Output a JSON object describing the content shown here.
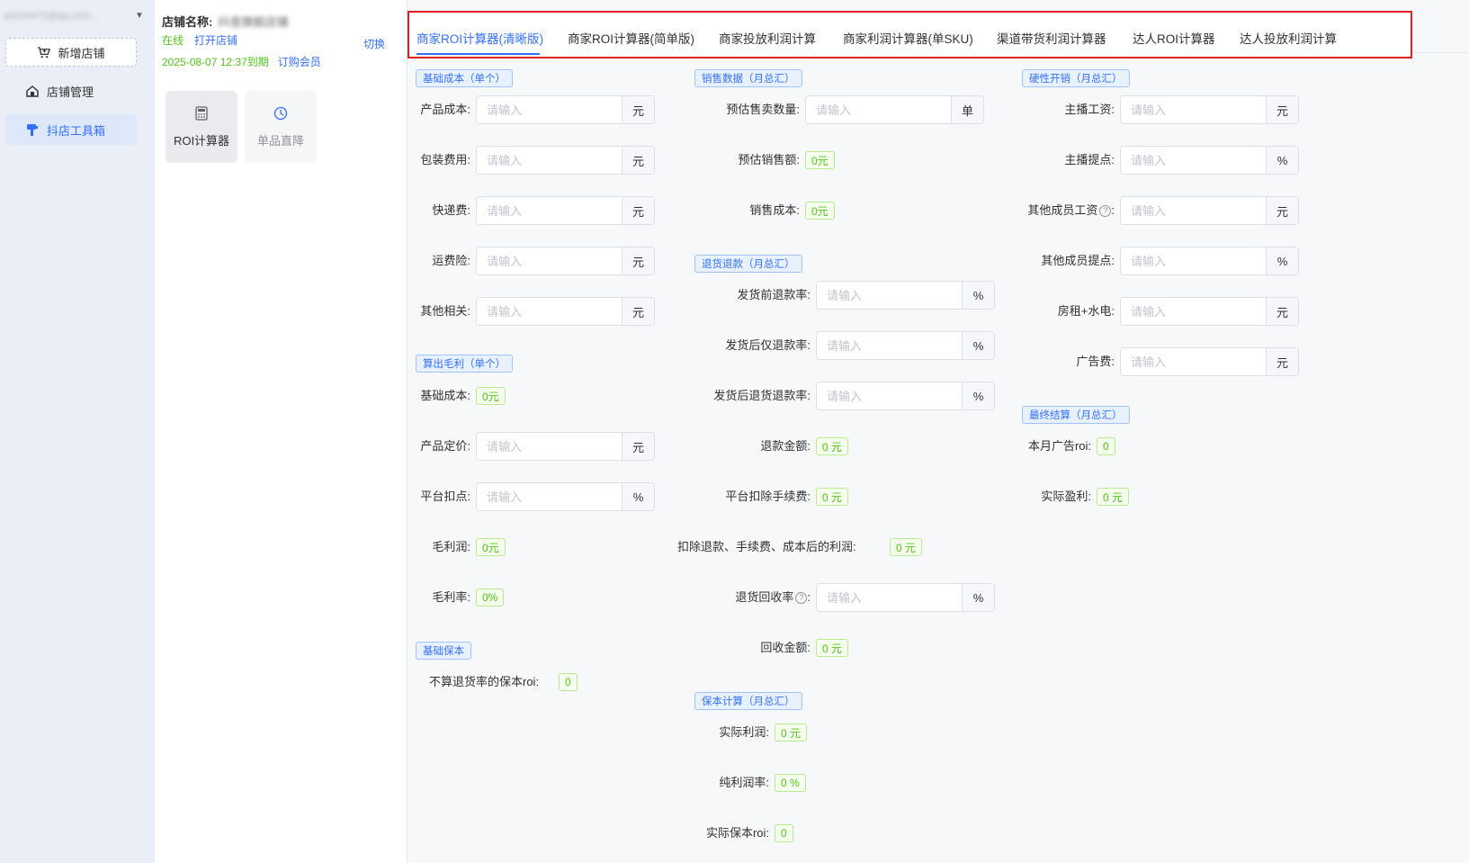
{
  "sidebar": {
    "account": "a0150472@qq.com...",
    "add_shop": "新增店铺",
    "items": [
      {
        "label": "店铺管理",
        "icon": "shop-icon"
      },
      {
        "label": "抖店工具箱",
        "icon": "toolbox-icon"
      }
    ]
  },
  "shop": {
    "name_label": "店铺名称:",
    "name_value": "抖音旗舰店铺",
    "status": "在线",
    "open_shop": "打开店铺",
    "switch": "切换",
    "expire": "2025-08-07 12:37到期",
    "subscribe": "订购会员",
    "tools": [
      {
        "label": "ROI计算器",
        "icon": "calculator-icon"
      },
      {
        "label": "单品直降",
        "icon": "clock-icon"
      }
    ]
  },
  "tabs": [
    "商家ROI计算器(清晰版)",
    "商家ROI计算器(简单版)",
    "商家投放利润计算",
    "商家利润计算器(单SKU)",
    "渠道带货利润计算器",
    "达人ROI计算器",
    "达人投放利润计算"
  ],
  "placeholder": "请输入",
  "col1": {
    "base_cost_tag": "基础成本（单个）",
    "product_cost": {
      "label": "产品成本:",
      "unit": "元"
    },
    "packaging": {
      "label": "包装费用:",
      "unit": "元"
    },
    "express": {
      "label": "快递费:",
      "unit": "元"
    },
    "freight_ins": {
      "label": "运费险:",
      "unit": "元"
    },
    "other": {
      "label": "其他相关:",
      "unit": "元"
    },
    "gross_tag": "算出毛利（单个）",
    "base_cost_total": {
      "label": "基础成本:",
      "value": "0元"
    },
    "price": {
      "label": "产品定价:",
      "unit": "元"
    },
    "platform_fee": {
      "label": "平台扣点:",
      "unit": "%"
    },
    "gross_profit": {
      "label": "毛利润:",
      "value": "0元"
    },
    "gross_rate": {
      "label": "毛利率:",
      "value": "0%"
    },
    "breakeven_tag": "基础保本",
    "breakeven_roi": {
      "label": "不算退货率的保本roi:",
      "value": "0"
    }
  },
  "col2": {
    "sales_tag": "销售数据（月总汇）",
    "est_qty": {
      "label": "预估售卖数量:",
      "unit": "单"
    },
    "est_sales": {
      "label": "预估销售额:",
      "value": "0元"
    },
    "sales_cost": {
      "label": "销售成本:",
      "value": "0元"
    },
    "refund_tag": "退货退款（月总汇）",
    "pre_ship_refund": {
      "label": "发货前退款率:",
      "unit": "%"
    },
    "post_ship_refund_only": {
      "label": "发货后仅退款率:",
      "unit": "%"
    },
    "post_ship_return": {
      "label": "发货后退货退款率:",
      "unit": "%"
    },
    "refund_amount": {
      "label": "退款金额:",
      "value": "0 元"
    },
    "platform_fee_deduct": {
      "label": "平台扣除手续费:",
      "value": "0 元"
    },
    "profit_after": {
      "label": "扣除退款、手续费、成本后的利润:",
      "value": "0 元"
    },
    "recovery_rate": {
      "label": "退货回收率",
      "unit": "%"
    },
    "recovery_amount": {
      "label": "回收金额:",
      "value": "0 元"
    },
    "breakeven_tag": "保本计算（月总汇）",
    "actual_profit": {
      "label": "实际利润:",
      "value": "0 元"
    },
    "net_margin": {
      "label": "纯利润率:",
      "value": "0 %"
    },
    "actual_roi": {
      "label": "实际保本roi:",
      "value": "0"
    }
  },
  "col3": {
    "fixed_tag": "硬性开销（月总汇）",
    "anchor_salary": {
      "label": "主播工资:",
      "unit": "元"
    },
    "anchor_commission": {
      "label": "主播提点:",
      "unit": "%"
    },
    "other_salary": {
      "label": "其他成员工资",
      "unit": "元"
    },
    "other_commission": {
      "label": "其他成员提点:",
      "unit": "%"
    },
    "rent": {
      "label": "房租+水电:",
      "unit": "元"
    },
    "ads": {
      "label": "广告费:",
      "unit": "元"
    },
    "final_tag": "最终结算（月总汇）",
    "month_roi": {
      "label": "本月广告roi:",
      "value": "0"
    },
    "actual_gain": {
      "label": "实际盈利:",
      "value": "0 元"
    }
  }
}
